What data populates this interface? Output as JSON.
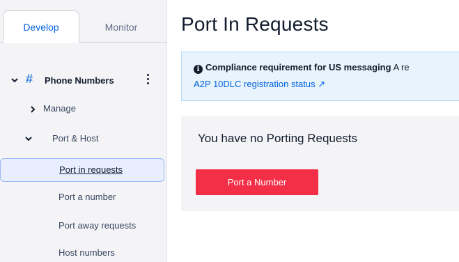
{
  "tabs": {
    "develop": "Develop",
    "monitor": "Monitor"
  },
  "sidebar": {
    "section_title": "Phone Numbers",
    "section_icon": "hash-icon",
    "items": [
      {
        "label": "Manage",
        "icon": "chevron-right-icon"
      },
      {
        "label": "Port & Host",
        "icon": "chevron-down-icon"
      },
      {
        "label": "Port in requests",
        "selected": true
      },
      {
        "label": "Port a number"
      },
      {
        "label": "Port away requests"
      },
      {
        "label": "Host numbers"
      }
    ]
  },
  "main": {
    "title": "Port In Requests",
    "banner": {
      "bold": "Compliance requirement for US messaging",
      "rest": " A re",
      "link": "A2P 10DLC registration status ↗"
    },
    "empty_state": {
      "text": "You have no Porting Requests",
      "button": "Port a Number"
    }
  },
  "colors": {
    "accent": "#0263e0",
    "button": "#f22f46",
    "banner_bg": "#e8f3fc",
    "sidebar_bg": "#f4f4f6"
  }
}
